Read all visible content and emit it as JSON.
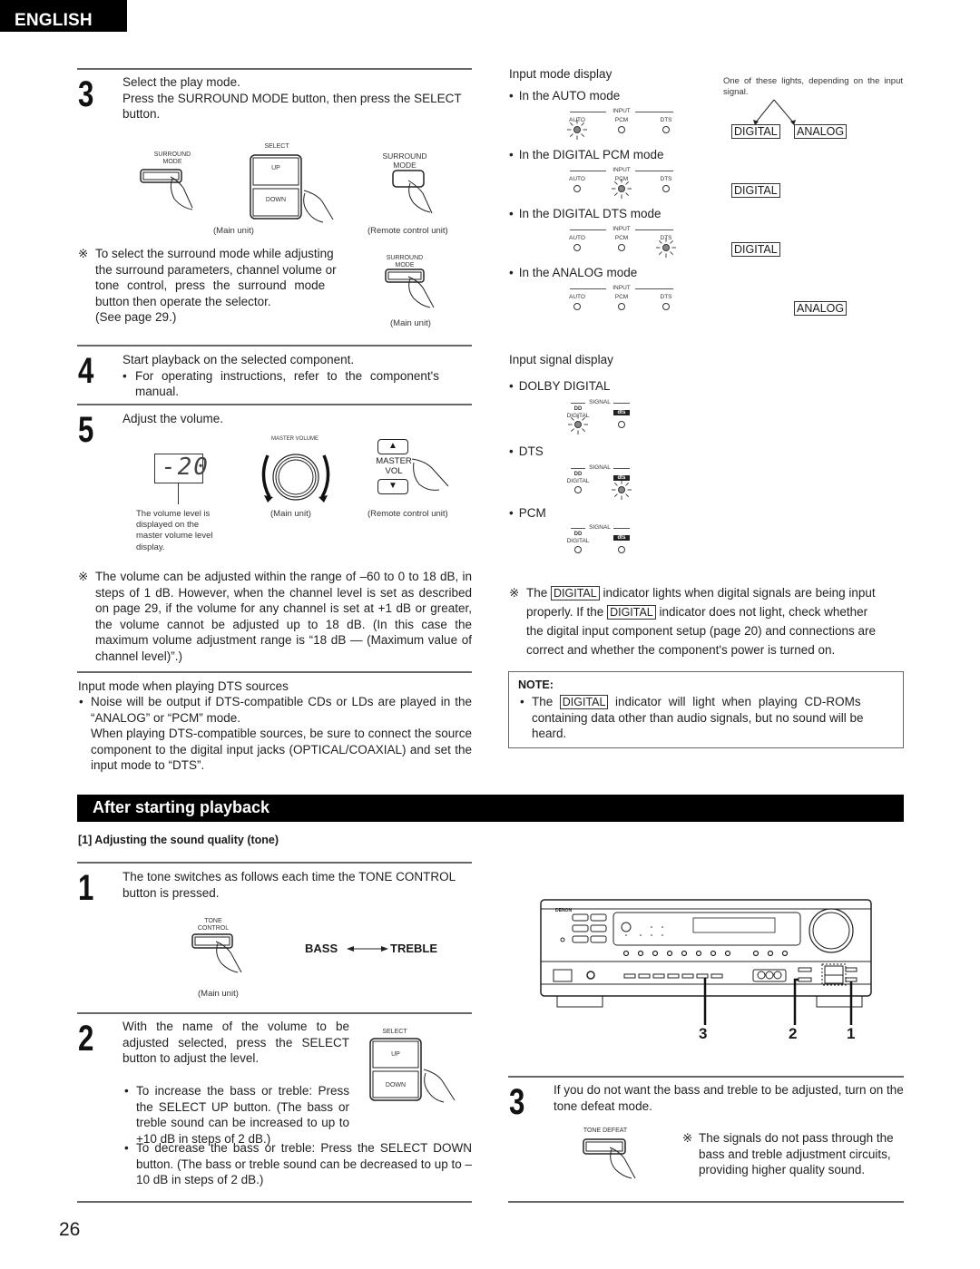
{
  "header": {
    "language_tab": "ENGLISH"
  },
  "page_number": "26",
  "left_column": {
    "step3": {
      "number": "3",
      "line1": "Select the play mode.",
      "line2": "Press the SURROUND MODE button, then press the SELECT button.",
      "fig": {
        "surround_mode_main_label_1": "SURROUND",
        "surround_mode_main_label_2": "MODE",
        "select_label": "SELECT",
        "up_label": "UP",
        "down_label": "DOWN",
        "surround_mode_remote_label_1": "SURROUND",
        "surround_mode_remote_label_2": "MODE",
        "caption_main": "(Main unit)",
        "caption_remote": "(Remote control unit)"
      },
      "note_mark": "※",
      "note_lines": [
        "To select the surround mode while adjusting",
        "the surround parameters, channel volume or",
        "tone control, press the surround mode",
        "button then operate the selector.",
        "(See page 29.)"
      ],
      "note_fig": {
        "label_1": "SURROUND",
        "label_2": "MODE",
        "caption": "(Main unit)"
      }
    },
    "step4": {
      "number": "4",
      "line1": "Start playback on the selected component.",
      "bullet": "For operating instructions, refer to the component's manual."
    },
    "step5": {
      "number": "5",
      "line1": "Adjust the volume.",
      "display_value": "-20",
      "display_caption": [
        "The volume level is",
        "displayed on the",
        "master volume level",
        "display."
      ],
      "master_volume_label": "MASTER VOLUME",
      "caption_main": "(Main unit)",
      "remote_label_1": "MASTER",
      "remote_label_2": "VOL",
      "remote_up": "▲",
      "remote_down": "▼",
      "caption_remote": "(Remote control unit)"
    },
    "volume_note": {
      "mark": "※",
      "text": "The volume can be adjusted within the range of –60 to 0 to 18 dB, in steps of 1 dB. However, when the channel level is set as described on page 29, if the volume for any channel is set at +1 dB or greater, the volume cannot be adjusted up to 18 dB. (In this case the maximum volume adjustment range is “18 dB — (Maximum value of channel level)”.)"
    },
    "dts_input": {
      "heading": "Input mode when playing DTS sources",
      "bullet": "Noise will be output if DTS-compatible CDs or LDs are played in the “ANALOG” or “PCM” mode.",
      "para": "When playing DTS-compatible sources, be sure to connect the source component to the digital input jacks (OPTICAL/COAXIAL) and set the input mode to “DTS”."
    }
  },
  "right_column": {
    "input_mode_display": {
      "heading": "Input mode display",
      "side_note": "One of these lights, depending on the input signal.",
      "group_label": "INPUT",
      "modes": [
        {
          "label": "In the AUTO mode",
          "lit": "AUTO",
          "indicators": [
            "DIGITAL",
            "ANALOG"
          ]
        },
        {
          "label": "In the DIGITAL PCM mode",
          "lit": "PCM",
          "indicators": [
            "DIGITAL"
          ]
        },
        {
          "label": "In the DIGITAL DTS mode",
          "lit": "DTS",
          "indicators": [
            "DIGITAL"
          ]
        },
        {
          "label": "In the ANALOG mode",
          "lit": "",
          "indicators": [
            "ANALOG"
          ]
        }
      ],
      "led_labels": [
        "AUTO",
        "PCM",
        "DTS"
      ]
    },
    "input_signal_display": {
      "heading": "Input signal display",
      "group_label": "SIGNAL",
      "dolby_label_top": "DD",
      "dolby_label": "DIGITAL",
      "dts_logo": "dts",
      "signals": [
        {
          "label": "DOLBY DIGITAL",
          "lit": "DIGITAL"
        },
        {
          "label": "DTS",
          "lit": "dts"
        },
        {
          "label": "PCM",
          "lit": ""
        }
      ]
    },
    "digital_note": {
      "mark": "※",
      "part1": "The",
      "indicator": "DIGITAL",
      "part2": "indicator lights when digital signals are being input",
      "part3": "properly. If the",
      "part4": "indicator does not light, check whether",
      "line3": "the digital input component setup (page 20) and connections are",
      "line4": "correct and whether the component's power is turned on."
    },
    "note_box": {
      "title": "NOTE:",
      "part1": "The",
      "indicator": "DIGITAL",
      "part2": "indicator will light when playing CD-ROMs",
      "line2": "containing data other than audio signals, but no sound will be",
      "line3": "heard."
    }
  },
  "after_playback": {
    "title": "After starting playback",
    "subheading": "[1]  Adjusting the sound quality (tone)",
    "step1": {
      "number": "1",
      "text": "The tone switches as follows each time the TONE CONTROL button is pressed.",
      "button_label_1": "TONE",
      "button_label_2": "CONTROL",
      "caption": "(Main unit)",
      "bass": "BASS",
      "treble": "TREBLE"
    },
    "step2": {
      "number": "2",
      "text": "With the name of the volume to be adjusted selected, press the SELECT button to adjust the level.",
      "select_label": "SELECT",
      "up_label": "UP",
      "down_label": "DOWN",
      "bullet1": "To increase the bass or treble: Press the SELECT UP button. (The bass or treble sound can be increased to up to +10 dB in steps of 2 dB.)",
      "bullet2": "To decrease the bass or treble: Press the SELECT DOWN button. (The bass or treble sound can be decreased to up to –10 dB in steps of 2 dB.)"
    },
    "receiver": {
      "brand": "DENON",
      "callouts": [
        "3",
        "2",
        "1"
      ]
    },
    "step3": {
      "number": "3",
      "text": "If you do not want the bass and treble to be adjusted, turn on the tone defeat mode.",
      "button_label": "TONE DEFEAT",
      "note_mark": "※",
      "note": "The signals do not pass through the bass and treble adjustment circuits, providing higher quality sound."
    }
  }
}
